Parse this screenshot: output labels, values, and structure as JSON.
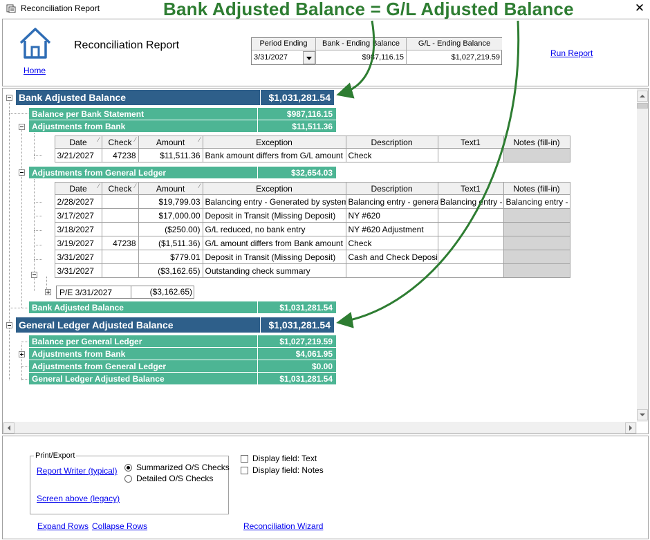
{
  "window": {
    "title": "Reconciliation Report"
  },
  "annotation": "Bank Adjusted Balance = G/L Adjusted Balance",
  "colors": {
    "blue_band": "#2e5f8a",
    "green_band": "#4db594",
    "annotation": "#2e7d32",
    "link": "#0000ee"
  },
  "header": {
    "report_title": "Reconciliation Report",
    "home_label": "Home",
    "run_report_label": "Run Report",
    "period_table": {
      "headers": [
        "Period Ending",
        "Bank - Ending Balance",
        "G/L - Ending Balance"
      ],
      "values": [
        "3/31/2027",
        "$987,116.15",
        "$1,027,219.59"
      ]
    }
  },
  "bank": {
    "title": "Bank Adjusted Balance",
    "amount": "$1,031,281.54",
    "balance_per_statement": {
      "label": "Balance per Bank Statement",
      "amount": "$987,116.15"
    },
    "adjustments_from_bank": {
      "label": "Adjustments from Bank",
      "amount": "$11,511.36",
      "headers": [
        "Date",
        "Check",
        "Amount",
        "Exception",
        "Description",
        "Text1",
        "Notes (fill-in)"
      ],
      "rows": [
        [
          "3/21/2027",
          "47238",
          "$11,511.36",
          "Bank amount differs from G/L amount",
          "Check",
          "",
          ""
        ]
      ]
    },
    "adjustments_from_gl": {
      "label": "Adjustments from General Ledger",
      "amount": "$32,654.03",
      "headers": [
        "Date",
        "Check",
        "Amount",
        "Exception",
        "Description",
        "Text1",
        "Notes (fill-in)"
      ],
      "rows": [
        [
          "2/28/2027",
          "",
          "$19,799.03",
          "Balancing entry - Generated by system",
          "Balancing entry - generated",
          "Balancing entry - g",
          "Balancing entry - g"
        ],
        [
          "3/17/2027",
          "",
          "$17,000.00",
          "Deposit in Transit (Missing Deposit)",
          "NY #620",
          "",
          ""
        ],
        [
          "3/18/2027",
          "",
          "($250.00)",
          "G/L reduced, no bank entry",
          "NY #620 Adjustment",
          "",
          ""
        ],
        [
          "3/19/2027",
          "47238",
          "($1,511.36)",
          "G/L amount differs from Bank amount",
          "Check",
          "",
          ""
        ],
        [
          "3/31/2027",
          "",
          "$779.01",
          "Deposit in Transit (Missing Deposit)",
          "Cash and Check Deposit",
          "",
          ""
        ],
        [
          "3/31/2027",
          "",
          "($3,162.65)",
          "Outstanding check summary",
          "",
          "",
          ""
        ]
      ],
      "subrow": {
        "label": "P/E 3/31/2027",
        "amount": "($3,162.65)"
      }
    },
    "footer": {
      "label": "Bank Adjusted Balance",
      "amount": "$1,031,281.54"
    }
  },
  "gl": {
    "title": "General Ledger Adjusted Balance",
    "amount": "$1,031,281.54",
    "rows": [
      {
        "label": "Balance per General Ledger",
        "amount": "$1,027,219.59"
      },
      {
        "label": "Adjustments from Bank",
        "amount": "$4,061.95"
      },
      {
        "label": "Adjustments from General Ledger",
        "amount": "$0.00"
      },
      {
        "label": "General Ledger Adjusted Balance",
        "amount": "$1,031,281.54"
      }
    ]
  },
  "footer": {
    "print_export_legend": "Print/Export",
    "report_writer_label": "Report Writer (typical)",
    "screen_above_label": "Screen above (legacy)",
    "radio_summarized": "Summarized O/S Checks",
    "radio_detailed": "Detailed O/S Checks",
    "check_text": "Display field: Text",
    "check_notes": "Display field: Notes",
    "expand_rows": "Expand Rows",
    "collapse_rows": "Collapse Rows",
    "reconciliation_wizard": "Reconciliation Wizard"
  }
}
